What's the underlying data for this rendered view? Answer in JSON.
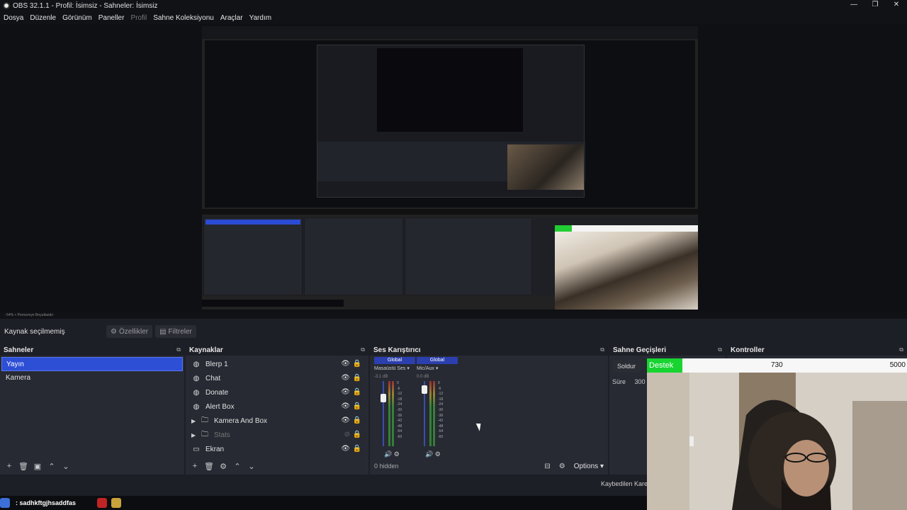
{
  "window": {
    "title": "OBS 32.1.1 - Profil: İsimsiz - Sahneler: İsimsiz",
    "min_icon": "minimize-icon",
    "max_icon": "maximize-icon",
    "close_icon": "close-icon"
  },
  "menu": {
    "items": [
      "Dosya",
      "Düzenle",
      "Görünüm",
      "Paneller",
      "Profil",
      "Sahne Koleksiyonu",
      "Araçlar",
      "Yardım"
    ],
    "disabled": [
      "Profil"
    ]
  },
  "preview": {
    "zoom_text": "- 54% + Pencereye Boyutlandır"
  },
  "context": {
    "source_label": "Kaynak seçilmemiş",
    "properties_label": "Özellikler",
    "filters_label": "Filtreler"
  },
  "scenes": {
    "title": "Sahneler",
    "items": [
      {
        "label": "Yayın",
        "active": true
      },
      {
        "label": "Kamera",
        "active": false
      }
    ]
  },
  "sources": {
    "title": "Kaynaklar",
    "items": [
      {
        "label": "Blerp 1",
        "icon": "browser-icon",
        "group": false,
        "visible": true
      },
      {
        "label": "Chat",
        "icon": "browser-icon",
        "group": false,
        "visible": true
      },
      {
        "label": "Donate",
        "icon": "browser-icon",
        "group": false,
        "visible": true
      },
      {
        "label": "Alert Box",
        "icon": "browser-icon",
        "group": false,
        "visible": true
      },
      {
        "label": "Kamera And Box",
        "icon": "folder-icon",
        "group": true,
        "visible": true
      },
      {
        "label": "Stats",
        "icon": "folder-icon",
        "group": true,
        "visible": false
      },
      {
        "label": "Ekran",
        "icon": "monitor-icon",
        "group": false,
        "visible": true
      }
    ]
  },
  "mixer": {
    "title": "Ses Karıştırıcı",
    "channels": [
      {
        "badge": "Global",
        "name": "Masaüstü Ses",
        "db": "-3.1 dB"
      },
      {
        "badge": "Global",
        "name": "Mic/Aux",
        "db": "0.0 dB"
      }
    ],
    "scale": [
      "0",
      "-6",
      "-12",
      "-18",
      "-24",
      "-30",
      "-36",
      "-42",
      "-48",
      "-54",
      "-60"
    ],
    "hidden_label": "0 hidden",
    "options_label": "Options"
  },
  "transitions": {
    "title": "Sahne Geçişleri",
    "fade_label": "Soldur",
    "duration_label": "Süre",
    "duration_value": "300 m"
  },
  "controls": {
    "title": "Kontroller"
  },
  "overlay": {
    "destek_label": "Destek",
    "mid_value": "730",
    "end_value": "5000",
    "dropped_label": "Kaybedilen Kare"
  },
  "taskbar": {
    "user_text": ": sadhkftgjhsaddfas"
  },
  "colors": {
    "accent": "#2d4fd6",
    "green": "#18d431",
    "bg": "#1d1f26",
    "dock": "#272a33"
  }
}
